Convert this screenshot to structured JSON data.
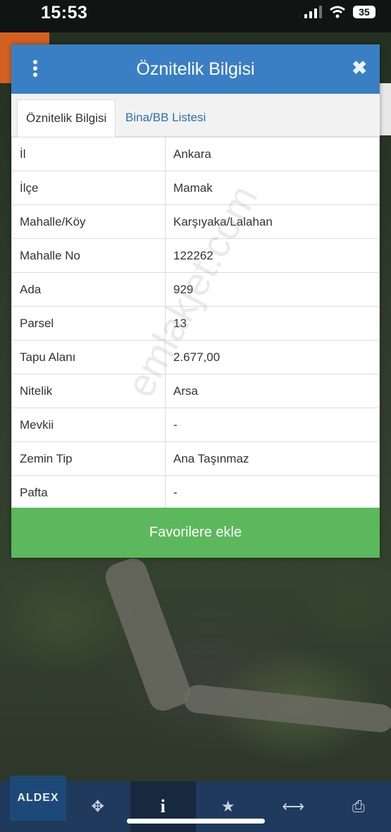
{
  "status": {
    "time": "15:53",
    "battery": "35"
  },
  "dialog": {
    "title": "Öznitelik Bilgisi",
    "tabs": [
      {
        "label": "Öznitelik Bilgisi",
        "active": true
      },
      {
        "label": "Bina/BB Listesi",
        "active": false
      }
    ],
    "rows": [
      {
        "key": "İl",
        "value": "Ankara"
      },
      {
        "key": "İlçe",
        "value": "Mamak"
      },
      {
        "key": "Mahalle/Köy",
        "value": "Karşıyaka/Lalahan"
      },
      {
        "key": "Mahalle No",
        "value": "122262"
      },
      {
        "key": "Ada",
        "value": "929"
      },
      {
        "key": "Parsel",
        "value": "13"
      },
      {
        "key": "Tapu Alanı",
        "value": "2.677,00"
      },
      {
        "key": "Nitelik",
        "value": "Arsa"
      },
      {
        "key": "Mevkii",
        "value": "-"
      },
      {
        "key": "Zemin Tip",
        "value": "Ana Taşınmaz"
      },
      {
        "key": "Pafta",
        "value": "-"
      }
    ],
    "favorite_button": "Favorilere ekle"
  },
  "watermark": "emlakjet.com",
  "toolbar": {
    "logo": "ALDEX",
    "items": [
      {
        "icon": "crosshair-icon",
        "glyph": "✥"
      },
      {
        "icon": "info-icon",
        "glyph": "i"
      },
      {
        "icon": "star-icon",
        "glyph": "★"
      },
      {
        "icon": "measure-icon",
        "glyph": "⟷"
      },
      {
        "icon": "print-icon",
        "glyph": "⎙"
      }
    ]
  },
  "colors": {
    "header": "#3a7fc4",
    "button": "#5cb85c",
    "toolbar": "#1f3a5c",
    "accent": "#d4601f"
  }
}
